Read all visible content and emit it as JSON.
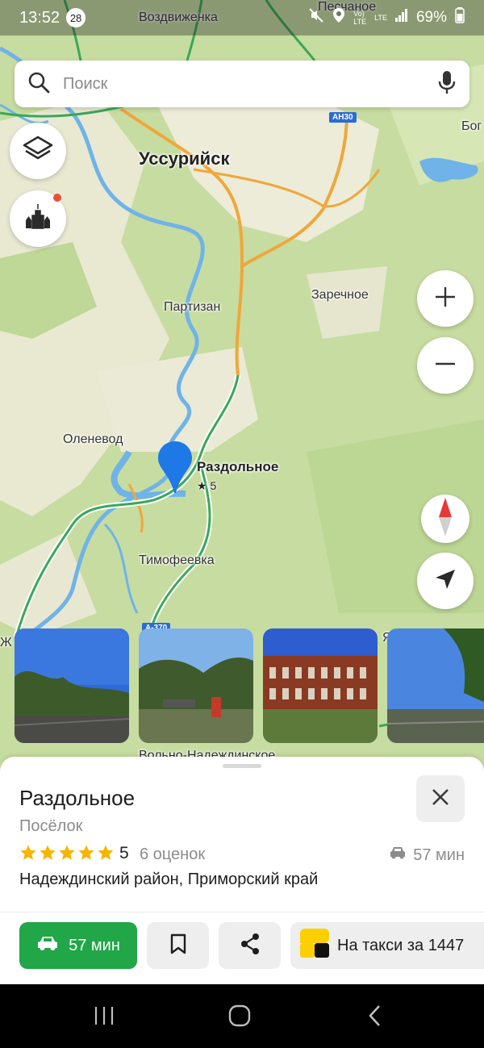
{
  "status_bar": {
    "time": "13:52",
    "notification_count": "28",
    "volte": "Vo)",
    "lte_small": "LTE",
    "lte": "LTE",
    "battery": "69%"
  },
  "search": {
    "placeholder": "Поиск"
  },
  "map": {
    "labels": {
      "vozdvizhenka": "Воздвиженка",
      "peschanoe": "Песчаное",
      "ussuriysk": "Уссурийск",
      "bog": "Бог",
      "partizan": "Партизан",
      "zarechnoe": "Заречное",
      "olenevod": "Оленевод",
      "razdolnoe": "Раздольное",
      "timofeevka": "Тимофеевка",
      "volno_nadezhdinskoe": "Вольно-Надеждинское",
      "edge_left": "Ж",
      "edge_right": "Я"
    },
    "road_badges": {
      "ah30": "АН30",
      "a370": "А-370"
    },
    "marker_rating": "★ 5"
  },
  "place": {
    "title": "Раздольное",
    "type": "Посёлок",
    "rating": "5",
    "stars": 5,
    "rating_count": "6 оценок",
    "drive_time": "57 мин",
    "address": "Надеждинский район, Приморский край"
  },
  "actions": {
    "route_label": "57 мин",
    "taxi_label": "На такси за 1447"
  },
  "colors": {
    "route_green": "#21a648",
    "marker_blue": "#1e78e6",
    "star_yellow": "#f7b500"
  }
}
